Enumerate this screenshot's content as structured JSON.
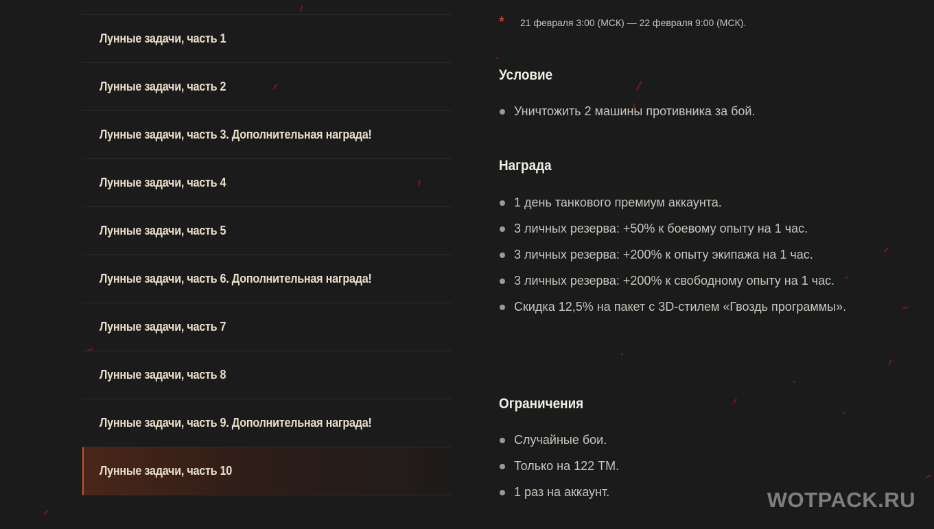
{
  "tasks": [
    {
      "label": "Лунные задачи, часть 1"
    },
    {
      "label": "Лунные задачи, часть 2"
    },
    {
      "label": "Лунные задачи, часть 3. Дополнительная награда!"
    },
    {
      "label": "Лунные задачи, часть 4"
    },
    {
      "label": "Лунные задачи, часть 5"
    },
    {
      "label": "Лунные задачи, часть 6. Дополнительная награда!"
    },
    {
      "label": "Лунные задачи, часть 7"
    },
    {
      "label": "Лунные задачи, часть 8"
    },
    {
      "label": "Лунные задачи, часть 9. Дополнительная награда!"
    },
    {
      "label": "Лунные задачи, часть 10",
      "active": true
    }
  ],
  "schedule": {
    "marker": "*",
    "text": "21 февраля 3:00 (МСК) — 22 февраля 9:00 (МСК)."
  },
  "condition": {
    "title": "Условие",
    "items": [
      "Уничтожить 2 машины противника за бой."
    ]
  },
  "reward": {
    "title": "Награда",
    "items": [
      "1 день танкового премиум аккаунта.",
      "3 личных резерва: +50% к боевому опыту на 1 час.",
      "3 личных резерва: +200% к опыту экипажа на 1 час.",
      "3 личных резерва: +200% к свободному опыту на 1 час.",
      "Скидка 12,5% на пакет с 3D-стилем «Гвоздь программы»."
    ]
  },
  "limits": {
    "title": "Ограничения",
    "items": [
      "Случайные бои.",
      "Только на 122 TM.",
      "1 раз на аккаунт."
    ]
  },
  "watermark": "WOTPACK.RU",
  "colors": {
    "background": "#1c1b1c",
    "accent": "#c4542b",
    "asterisk": "#d23a2a"
  }
}
